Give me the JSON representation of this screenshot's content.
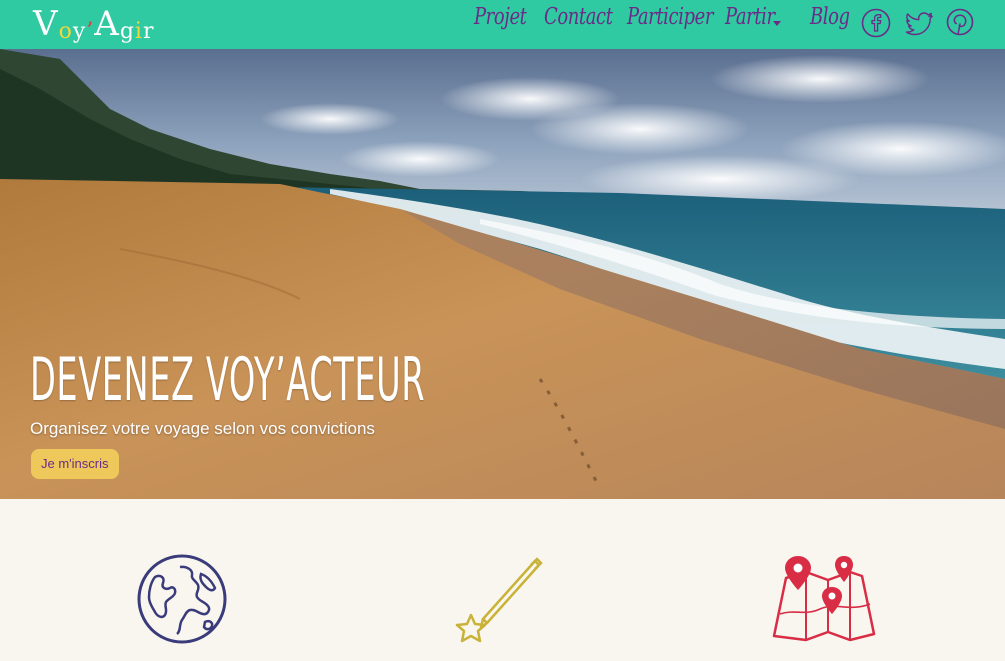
{
  "brand": {
    "logo_parts": [
      "V",
      "o",
      "y",
      "’",
      "A",
      "g",
      "i",
      "r"
    ]
  },
  "nav": {
    "items": [
      {
        "label": "Projet"
      },
      {
        "label": "Contact"
      },
      {
        "label": "Participer"
      },
      {
        "label": "Partir"
      },
      {
        "label": "Blog"
      }
    ],
    "social": [
      "facebook-icon",
      "twitter-icon",
      "pinterest-icon"
    ]
  },
  "hero": {
    "title": "DEVENEZ VOY’ACTEUR",
    "subtitle": "Organisez votre voyage selon vos convictions",
    "cta_label": "Je m'inscris"
  },
  "features": {
    "icons": [
      "globe-icon",
      "pen-star-icon",
      "map-pins-icon"
    ]
  },
  "colors": {
    "navbar": "#2fc9a2",
    "nav_text": "#6a2c87",
    "cta_bg": "#eec85a",
    "page_bg": "#f8f6ef"
  }
}
